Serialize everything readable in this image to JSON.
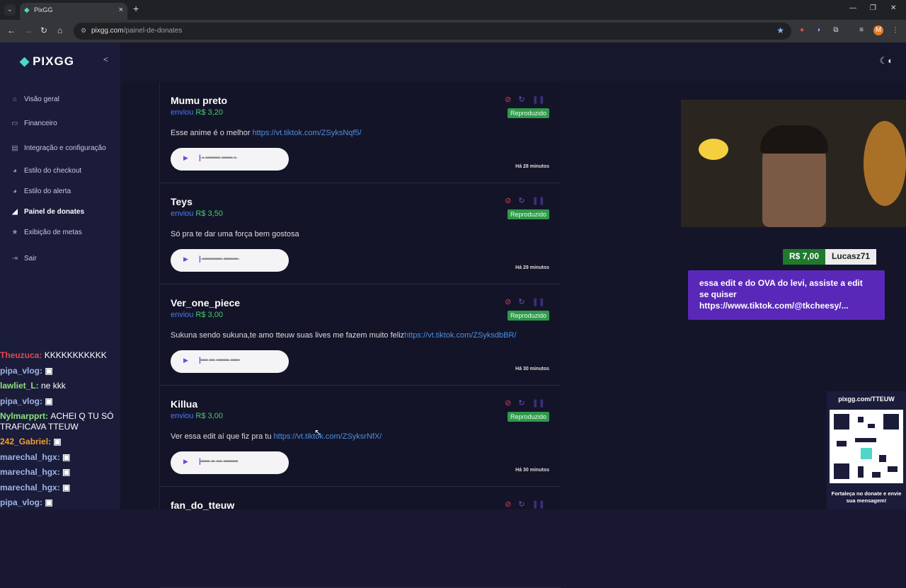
{
  "browser": {
    "tab_title": "PixGG",
    "url_host": "pixgg.com",
    "url_path": "/painel-de-donates",
    "profile_initial": "M"
  },
  "sidebar": {
    "logo": "PIXGG",
    "items": [
      {
        "label": "Visão geral",
        "icon": "home-icon"
      },
      {
        "label": "Financeiro",
        "icon": "wallet-icon"
      },
      {
        "label": "Integração e configuração",
        "icon": "settings-icon"
      },
      {
        "label": "Estilo do checkout",
        "icon": "palette-icon"
      },
      {
        "label": "Estilo do alerta",
        "icon": "palette-icon"
      },
      {
        "label": "Painel de donates",
        "icon": "megaphone-icon"
      },
      {
        "label": "Exibição de metas",
        "icon": "star-icon"
      },
      {
        "label": "Sair",
        "icon": "logout-icon"
      }
    ]
  },
  "donations": [
    {
      "name": "Mumu preto",
      "sent": "enviou",
      "amount": "R$ 3,20",
      "message": "Esse anime é o melhor ",
      "link": "https://vt.tiktok.com/ZSyksNqf5/",
      "status": "Reproduzido",
      "time": "Há 28 minutos"
    },
    {
      "name": "Teys",
      "sent": "enviou",
      "amount": "R$ 3,50",
      "message": "Só pra te dar uma força bem gostosa",
      "link": "",
      "status": "Reproduzido",
      "time": "Há 29 minutos"
    },
    {
      "name": "Ver_one_piece",
      "sent": "enviou",
      "amount": "R$ 3,00",
      "message": "Sukuna sendo sukuna,te amo tteuw suas lives me fazem muito feliz",
      "link": "https://vt.tiktok.com/ZSyksdbBR/",
      "status": "Reproduzido",
      "time": "Há 30 minutos"
    },
    {
      "name": "Killua",
      "sent": "enviou",
      "amount": "R$ 3,00",
      "message": "Ver essa edit aí que fiz pra tu ",
      "link": "https://vt.tiktok.com/ZSyksrNfX/",
      "status": "Reproduzido",
      "time": "Há 30 minutos"
    },
    {
      "name": "fan_do_tteuw",
      "sent": "",
      "amount": "",
      "message": "",
      "link": "",
      "status": "",
      "time": ""
    }
  ],
  "overlay": {
    "donation_value": "R$ 7,00",
    "donation_user": "Lucasz71",
    "donation_message": "essa edit e do OVA do levi, assiste a edit se quiser https://www.tiktok.com/@tkcheesy/...",
    "qr_header": "pixgg.com/TTEUW",
    "qr_footer": "Fortaleça no donate e envie sua mensagem!"
  },
  "chat": [
    {
      "user": "Theuzuca:",
      "text": "KKKKKKKKKKK",
      "color": "#e5484d"
    },
    {
      "user": "pipa_vlog:",
      "text": "",
      "color": "#9fb4e6"
    },
    {
      "user": "lawliet_L:",
      "text": "ne kkk",
      "color": "#8fe37a"
    },
    {
      "user": "pipa_vlog:",
      "text": "",
      "color": "#9fb4e6"
    },
    {
      "user": "Nylmarpprt:",
      "text": "ACHEI Q TU SÓ TRAFICAVA TTEUW",
      "color": "#8fe37a"
    },
    {
      "user": "242_Gabriel:",
      "text": "",
      "color": "#f0a030"
    },
    {
      "user": "marechal_hgx:",
      "text": "",
      "color": "#9fb4e6"
    },
    {
      "user": "marechal_hgx:",
      "text": "",
      "color": "#9fb4e6"
    },
    {
      "user": "marechal_hgx:",
      "text": "",
      "color": "#9fb4e6"
    },
    {
      "user": "pipa_vlog:",
      "text": "",
      "color": "#9fb4e6"
    }
  ]
}
